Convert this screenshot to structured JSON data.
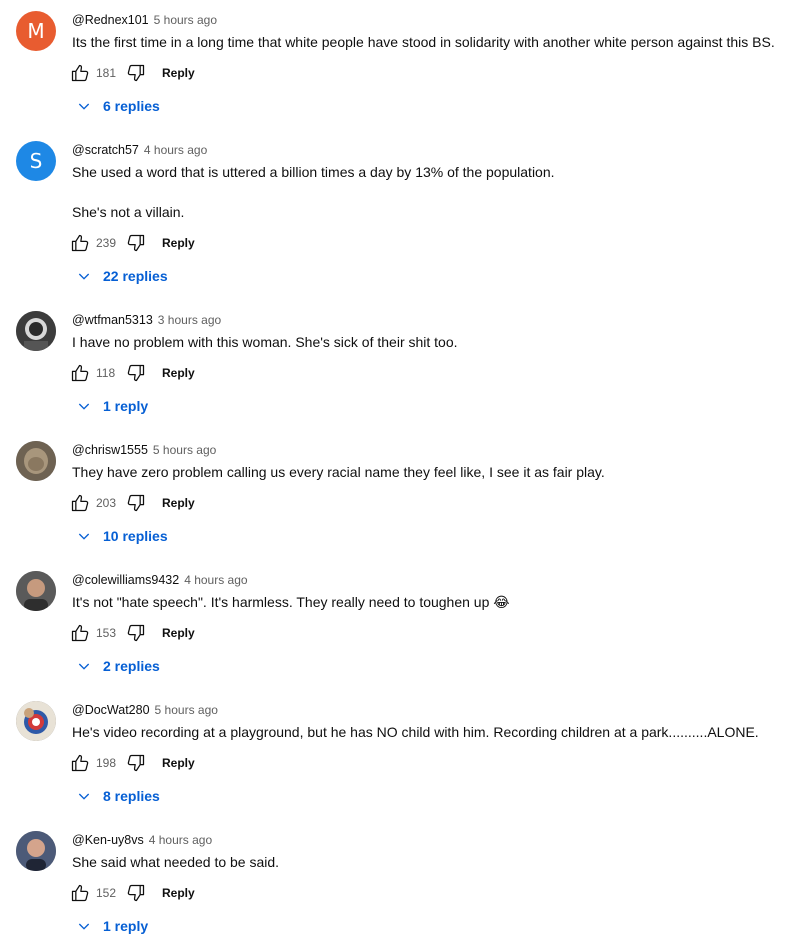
{
  "ui": {
    "reply_label": "Reply"
  },
  "comments": [
    {
      "avatar_letter": "M",
      "avatar_color": "#e85c30",
      "author": "@Rednex101",
      "time": "5 hours ago",
      "lines": [
        "Its the first time in a long time that white people have stood in solidarity with another white person against this BS."
      ],
      "likes": "181",
      "replies": "6 replies"
    },
    {
      "avatar_letter": "S",
      "avatar_color": "#1e88e5",
      "author": "@scratch57",
      "time": "4 hours ago",
      "lines": [
        "She used a word that is uttered a billion times a day by 13% of the population.",
        "She's not a villain."
      ],
      "likes": "239",
      "replies": "22 replies"
    },
    {
      "avatar_letter": "",
      "avatar_color": "#4a4a4a",
      "author": "@wtfman5313",
      "time": "3 hours ago",
      "lines": [
        "I have no problem with this woman. She's sick of their shit too."
      ],
      "likes": "118",
      "replies": "1 reply"
    },
    {
      "avatar_letter": "",
      "avatar_color": "#8a7a66",
      "author": "@chrisw1555",
      "time": "5 hours ago",
      "lines": [
        "They have zero problem calling us every racial name they feel like, I see it as fair play."
      ],
      "likes": "203",
      "replies": "10 replies"
    },
    {
      "avatar_letter": "",
      "avatar_color": "#6b6b6b",
      "author": "@colewilliams9432",
      "time": "4 hours ago",
      "lines": [
        "It's not \"hate speech\". It's harmless. They really need to toughen up 😂"
      ],
      "likes": "153",
      "replies": "2 replies"
    },
    {
      "avatar_letter": "",
      "avatar_color": "#3a5ba0",
      "author": "@DocWat280",
      "time": "5 hours ago",
      "lines": [
        "He's video recording at a playground, but he has NO child with him. Recording children at a park..........ALONE."
      ],
      "likes": "198",
      "replies": "8 replies"
    },
    {
      "avatar_letter": "",
      "avatar_color": "#5a6b8c",
      "author": "@Ken-uy8vs",
      "time": "4 hours ago",
      "lines": [
        "She said what needed to be said."
      ],
      "likes": "152",
      "replies": "1 reply"
    }
  ]
}
